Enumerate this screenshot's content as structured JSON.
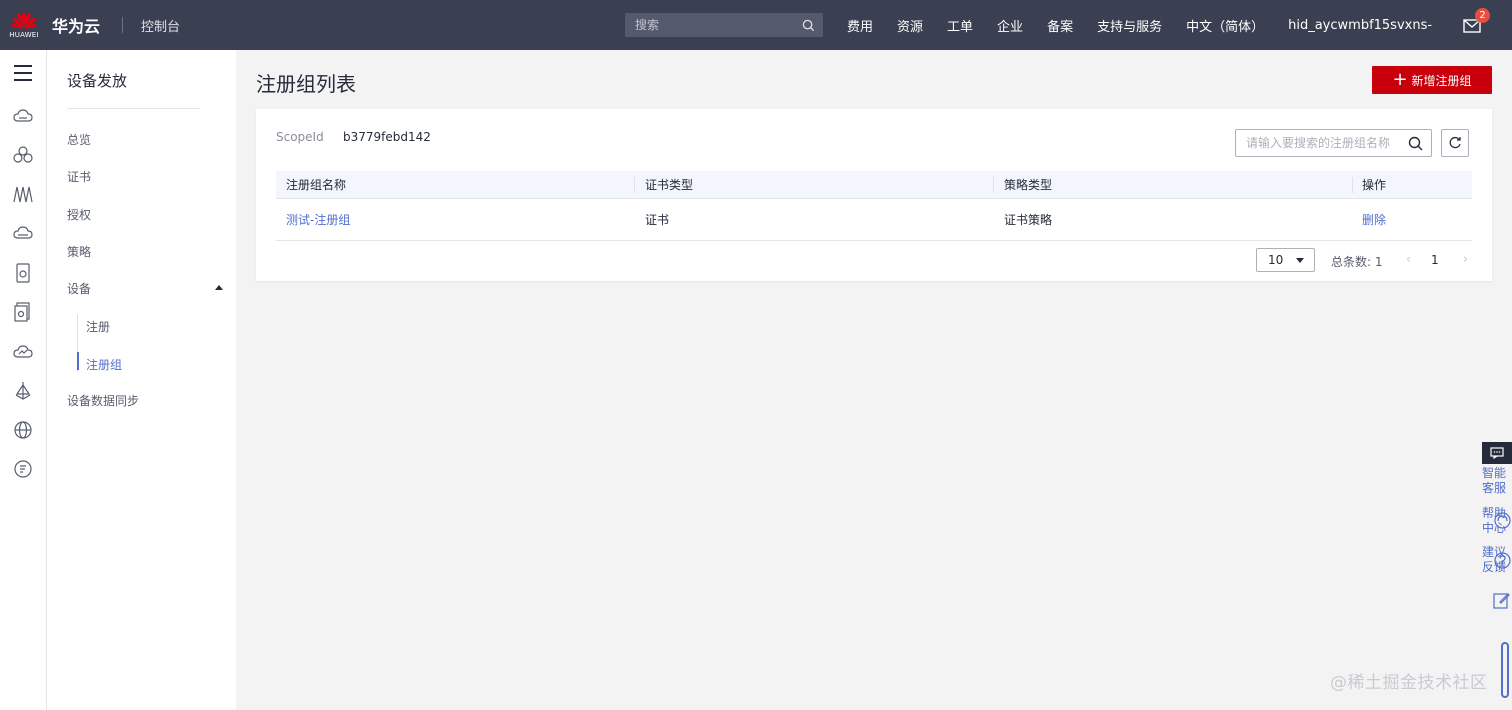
{
  "topbar": {
    "logo_text": "HUAWEI",
    "brand": "华为云",
    "console": "控制台",
    "search_placeholder": "搜索",
    "nav": [
      "费用",
      "资源",
      "工单",
      "企业",
      "备案",
      "支持与服务",
      "中文（简体）",
      "hid_aycwmbf15svxns-"
    ],
    "mail_badge": "2"
  },
  "subnav": {
    "title": "设备发放",
    "items": [
      "总览",
      "证书",
      "授权",
      "策略",
      "设备"
    ],
    "children": [
      "注册",
      "注册组"
    ],
    "last": "设备数据同步"
  },
  "main": {
    "title": "注册组列表",
    "add_button": "新增注册组",
    "scope_label": "ScopeId",
    "scope_value": "b3779febd142",
    "search_placeholder": "请输入要搜索的注册组名称",
    "columns": [
      "注册组名称",
      "证书类型",
      "策略类型",
      "操作"
    ],
    "rows": [
      {
        "name": "测试-注册组",
        "cert_type": "证书",
        "policy_type": "证书策略",
        "action": "删除"
      }
    ],
    "page_size": "10",
    "total": "总条数: 1",
    "current_page": "1"
  },
  "float": {
    "items": [
      "智能客服",
      "帮助中心",
      "建议反馈"
    ]
  },
  "watermark": "@稀土掘金技术社区",
  "colors": {
    "topbar": "#3a3f51",
    "accent": "#526ecc",
    "primary_button": "#c7000b"
  }
}
